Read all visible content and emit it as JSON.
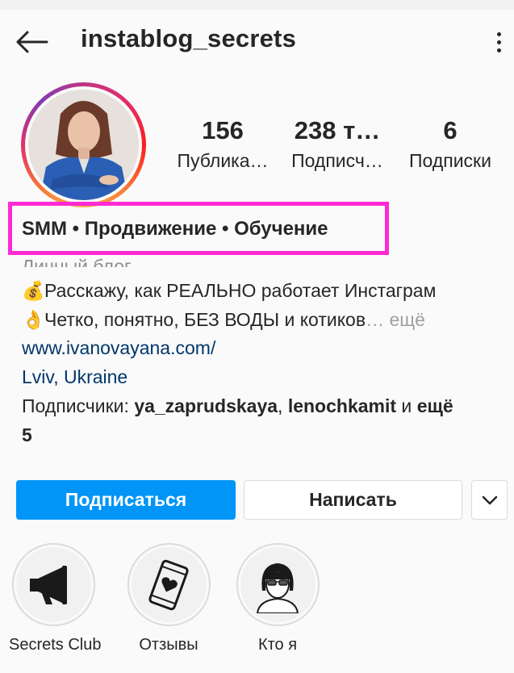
{
  "header": {
    "username": "instablog_secrets",
    "back_icon": "arrow-left-icon",
    "menu_icon": "more-vertical-icon"
  },
  "stats": {
    "posts": {
      "value": "156",
      "label": "Публика…"
    },
    "followers": {
      "value": "238 т…",
      "label": "Подписч…"
    },
    "following": {
      "value": "6",
      "label": "Подписки"
    }
  },
  "profile": {
    "full_name": "SMM • Продвижение • Обучение",
    "category": "Личный блог",
    "bio_line1_emoji": "💰",
    "bio_line1": "Расскажу, как РЕАЛЬНО работает Инстаграм",
    "bio_line2_emoji": "👌",
    "bio_line2": "Четко, понятно, БЕЗ ВОДЫ и котиков",
    "bio_more": "… ещё",
    "website": "www.ivanovayana.com/",
    "location": "Lviv, Ukraine",
    "followed_by_prefix": "Подписчики: ",
    "followed_by_user1": "ya_zaprudskaya",
    "followed_by_sep": ", ",
    "followed_by_user2": "lenochkamit",
    "followed_by_and": " и ",
    "followed_by_more": "ещё",
    "followed_by_count": "5"
  },
  "actions": {
    "follow_label": "Подписаться",
    "message_label": "Написать",
    "dropdown_icon": "chevron-down-icon"
  },
  "highlights": [
    {
      "label": "Secrets Club",
      "icon": "megaphone-icon"
    },
    {
      "label": "Отзывы",
      "icon": "phone-heart-icon"
    },
    {
      "label": "Кто я",
      "icon": "person-glasses-icon"
    }
  ],
  "colors": {
    "accent": "#0095f6",
    "annotation_box": "#ff2ad3",
    "link": "#00376b"
  }
}
